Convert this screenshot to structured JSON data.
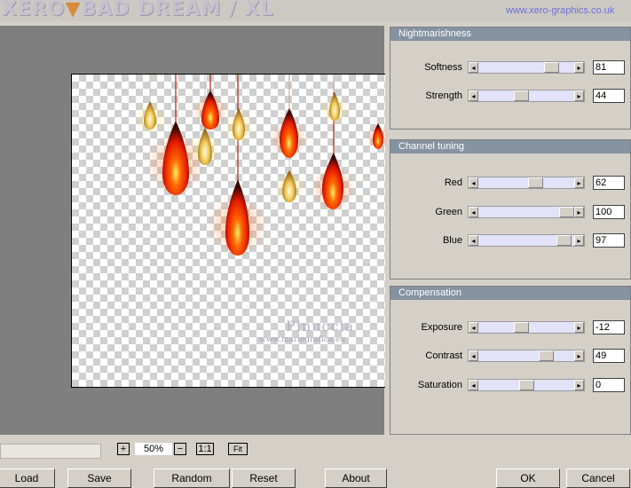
{
  "header": {
    "logo_left": "XERO",
    "logo_right": "BAD DREAM / XL",
    "site": "www.xero-graphics.co.uk"
  },
  "watermark": {
    "name": "Pinuccia",
    "url": "www.mariegrafica.eu"
  },
  "panels": [
    {
      "title": "Nightmarishness",
      "sliders": [
        {
          "label": "Softness",
          "value": "81",
          "level": 0.81
        },
        {
          "label": "Strength",
          "value": "44",
          "level": 0.44
        }
      ]
    },
    {
      "title": "Channel tuning",
      "sliders": [
        {
          "label": "Red",
          "value": "62",
          "level": 0.62
        },
        {
          "label": "Green",
          "value": "100",
          "level": 1.0
        },
        {
          "label": "Blue",
          "value": "97",
          "level": 0.97
        }
      ]
    },
    {
      "title": "Compensation",
      "sliders": [
        {
          "label": "Exposure",
          "value": "-12",
          "level": 0.44
        },
        {
          "label": "Contrast",
          "value": "49",
          "level": 0.745
        },
        {
          "label": "Saturation",
          "value": "0",
          "level": 0.5
        }
      ]
    }
  ],
  "zoom": {
    "plus": "+",
    "value": "50%",
    "minus": "−",
    "one_to_one": "1:1",
    "fit": "Fit"
  },
  "buttons": {
    "load": "Load",
    "save": "Save",
    "random": "Random",
    "reset": "Reset",
    "about": "About",
    "ok": "OK",
    "cancel": "Cancel"
  },
  "colors": {
    "panel_title_bg": "#8592a1",
    "preview_bg": "#7f7f7f",
    "slider_track": "#e2e2f8",
    "site_link": "#6f6fd9"
  }
}
